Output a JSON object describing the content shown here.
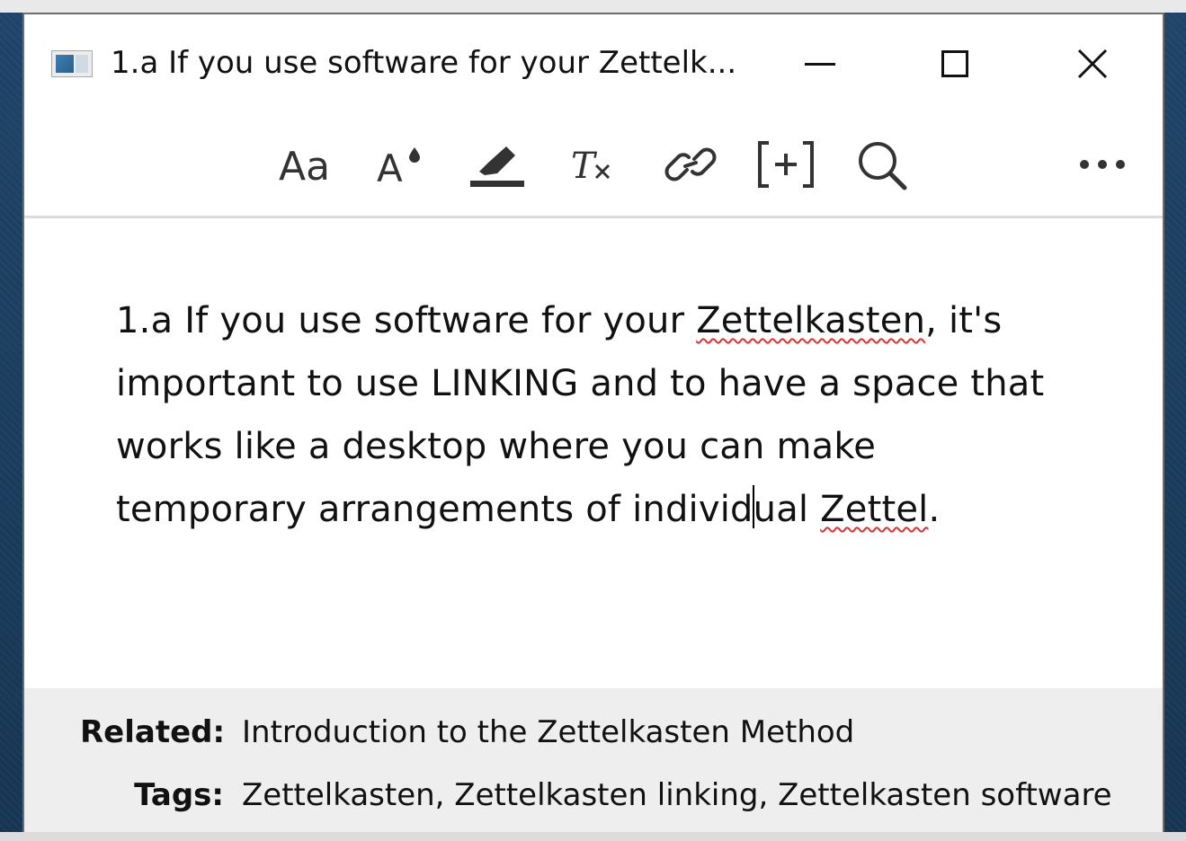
{
  "window": {
    "title": "1.a If you use software for your Zettelk..."
  },
  "toolbar": {
    "icons": [
      "font-size-icon",
      "font-color-icon",
      "highlight-icon",
      "clear-formatting-icon",
      "link-icon",
      "insert-note-icon",
      "search-icon",
      "more-icon"
    ]
  },
  "note": {
    "line1_a": "1.a If you use software for your ",
    "line1_spell": "Zettelkasten",
    "line1_b": ", it's",
    "line2": "important to use LINKING and to have a space that",
    "line3": "works like a desktop where you can make",
    "line4_a": "temporary arrangements of individ",
    "line4_b": "ual ",
    "line4_spell": "Zettel",
    "line4_c": "."
  },
  "footer": {
    "related_label": "Related:",
    "related_value": "Introduction to the Zettelkasten Method",
    "tags_label": "Tags:",
    "tags_value": "Zettelkasten, Zettelkasten linking, Zettelkasten software"
  }
}
